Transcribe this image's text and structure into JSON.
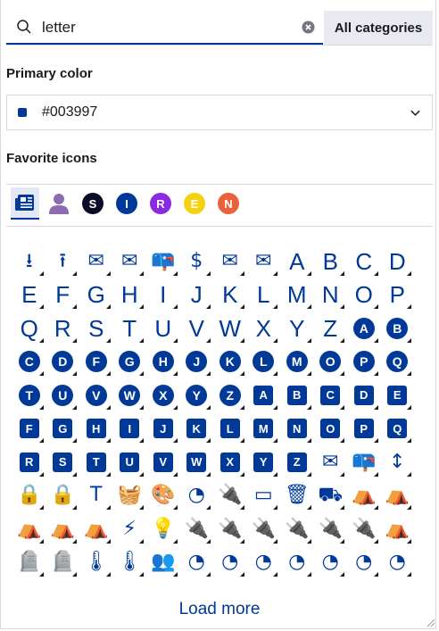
{
  "search": {
    "value": "letter",
    "clear_icon": "close-circle-icon",
    "search_icon": "search-icon"
  },
  "category_button": {
    "label": "All categories"
  },
  "primary_color": {
    "label": "Primary color",
    "value": "#003997",
    "swatch": "#003997"
  },
  "favorites": {
    "label": "Favorite icons",
    "items": [
      {
        "kind": "icon",
        "icon": "newspaper-icon",
        "selected": true
      },
      {
        "kind": "icon",
        "icon": "user-icon",
        "color": "#8c6bb1"
      },
      {
        "kind": "circle",
        "text": "S",
        "color": "#0b0b2a"
      },
      {
        "kind": "circle",
        "text": "I",
        "color": "#003997"
      },
      {
        "kind": "circle",
        "text": "R",
        "color": "#8a2be2"
      },
      {
        "kind": "circle",
        "text": "E",
        "color": "#f5d20f"
      },
      {
        "kind": "circle",
        "text": "N",
        "color": "#e8623a"
      }
    ]
  },
  "icons": [
    {
      "type": "icon",
      "glyph": "⭳",
      "name": "download-icon"
    },
    {
      "type": "icon",
      "glyph": "⭱",
      "name": "upload-icon"
    },
    {
      "type": "icon",
      "glyph": "✉",
      "name": "envelope-icon"
    },
    {
      "type": "icon",
      "glyph": "✉",
      "name": "envelope-open-icon"
    },
    {
      "type": "icon",
      "glyph": "📪",
      "name": "mailbox-icon"
    },
    {
      "type": "icon",
      "glyph": "$",
      "name": "envelope-dollar-icon"
    },
    {
      "type": "icon",
      "glyph": "✉",
      "name": "envelope-open-text-icon"
    },
    {
      "type": "icon",
      "glyph": "✉",
      "name": "mail-bulk-icon"
    },
    {
      "type": "letter",
      "text": "A"
    },
    {
      "type": "letter",
      "text": "B"
    },
    {
      "type": "letter",
      "text": "C"
    },
    {
      "type": "letter",
      "text": "D"
    },
    {
      "type": "letter",
      "text": "E"
    },
    {
      "type": "letter",
      "text": "F"
    },
    {
      "type": "letter",
      "text": "G"
    },
    {
      "type": "letter",
      "text": "H"
    },
    {
      "type": "letter",
      "text": "I"
    },
    {
      "type": "letter",
      "text": "J"
    },
    {
      "type": "letter",
      "text": "K"
    },
    {
      "type": "letter",
      "text": "L"
    },
    {
      "type": "letter",
      "text": "M"
    },
    {
      "type": "letter",
      "text": "N"
    },
    {
      "type": "letter",
      "text": "O"
    },
    {
      "type": "letter",
      "text": "P"
    },
    {
      "type": "letter",
      "text": "Q"
    },
    {
      "type": "letter",
      "text": "R"
    },
    {
      "type": "letter",
      "text": "S"
    },
    {
      "type": "letter",
      "text": "T"
    },
    {
      "type": "letter",
      "text": "U"
    },
    {
      "type": "letter",
      "text": "V"
    },
    {
      "type": "letter",
      "text": "W"
    },
    {
      "type": "letter",
      "text": "X"
    },
    {
      "type": "letter",
      "text": "Y"
    },
    {
      "type": "letter",
      "text": "Z"
    },
    {
      "type": "circle",
      "text": "A"
    },
    {
      "type": "circle",
      "text": "B"
    },
    {
      "type": "circle",
      "text": "C"
    },
    {
      "type": "circle",
      "text": "D"
    },
    {
      "type": "circle",
      "text": "F"
    },
    {
      "type": "circle",
      "text": "G"
    },
    {
      "type": "circle",
      "text": "H"
    },
    {
      "type": "circle",
      "text": "J"
    },
    {
      "type": "circle",
      "text": "K"
    },
    {
      "type": "circle",
      "text": "L"
    },
    {
      "type": "circle",
      "text": "M"
    },
    {
      "type": "circle",
      "text": "O"
    },
    {
      "type": "circle",
      "text": "P"
    },
    {
      "type": "circle",
      "text": "Q"
    },
    {
      "type": "circle",
      "text": "T"
    },
    {
      "type": "circle",
      "text": "U"
    },
    {
      "type": "circle",
      "text": "V"
    },
    {
      "type": "circle",
      "text": "W"
    },
    {
      "type": "circle",
      "text": "X"
    },
    {
      "type": "circle",
      "text": "Y"
    },
    {
      "type": "circle",
      "text": "Z"
    },
    {
      "type": "square",
      "text": "A"
    },
    {
      "type": "square",
      "text": "B"
    },
    {
      "type": "square",
      "text": "C"
    },
    {
      "type": "square",
      "text": "D"
    },
    {
      "type": "square",
      "text": "E"
    },
    {
      "type": "square",
      "text": "F"
    },
    {
      "type": "square",
      "text": "G"
    },
    {
      "type": "square",
      "text": "H"
    },
    {
      "type": "square",
      "text": "I"
    },
    {
      "type": "square",
      "text": "J"
    },
    {
      "type": "square",
      "text": "K"
    },
    {
      "type": "square",
      "text": "L"
    },
    {
      "type": "square",
      "text": "M"
    },
    {
      "type": "square",
      "text": "N"
    },
    {
      "type": "square",
      "text": "O"
    },
    {
      "type": "square",
      "text": "P"
    },
    {
      "type": "square",
      "text": "Q"
    },
    {
      "type": "square",
      "text": "R"
    },
    {
      "type": "square",
      "text": "S"
    },
    {
      "type": "square",
      "text": "T"
    },
    {
      "type": "square",
      "text": "U"
    },
    {
      "type": "square",
      "text": "V"
    },
    {
      "type": "square",
      "text": "W"
    },
    {
      "type": "square",
      "text": "X"
    },
    {
      "type": "square",
      "text": "Y"
    },
    {
      "type": "square",
      "text": "Z"
    },
    {
      "type": "icon",
      "glyph": "✉",
      "name": "square-envelope-icon"
    },
    {
      "type": "icon",
      "glyph": "📪",
      "name": "mailbox-flag-icon"
    },
    {
      "type": "icon",
      "glyph": "↕",
      "name": "arrow-up-down-list-icon"
    },
    {
      "type": "icon",
      "glyph": "🔒",
      "name": "lock-a-icon"
    },
    {
      "type": "icon",
      "glyph": "🔒",
      "name": "lock-a-square-icon"
    },
    {
      "type": "icon",
      "glyph": "T",
      "name": "text-icon"
    },
    {
      "type": "icon",
      "glyph": "🧺",
      "name": "basket-icon"
    },
    {
      "type": "icon",
      "glyph": "🎨",
      "name": "palette-icon"
    },
    {
      "type": "icon",
      "glyph": "◔",
      "name": "gauge-bolt-icon"
    },
    {
      "type": "icon",
      "glyph": "🔌",
      "name": "plug-icon"
    },
    {
      "type": "icon",
      "glyph": "▭",
      "name": "battery-icon"
    },
    {
      "type": "icon",
      "glyph": "🗑",
      "name": "trash-bin-icon"
    },
    {
      "type": "icon",
      "glyph": "⛟",
      "name": "wagon-icon"
    },
    {
      "type": "icon",
      "glyph": "⛺",
      "name": "tent-arrow-down-icon"
    },
    {
      "type": "icon",
      "glyph": "⛺",
      "name": "tent-arrows-icon"
    },
    {
      "type": "icon",
      "glyph": "⛺",
      "name": "tent-arrow-turn-icon"
    },
    {
      "type": "icon",
      "glyph": "⛺",
      "name": "tents-arrow-down-icon"
    },
    {
      "type": "icon",
      "glyph": "⛺",
      "name": "tent-icon"
    },
    {
      "type": "icon",
      "glyph": "⚡",
      "name": "bolt-icon"
    },
    {
      "type": "icon",
      "glyph": "💡",
      "name": "lightbulb-icon"
    },
    {
      "type": "icon",
      "glyph": "🔌",
      "name": "plug-bolt-icon"
    },
    {
      "type": "icon",
      "glyph": "🔌",
      "name": "plug-check-icon"
    },
    {
      "type": "icon",
      "glyph": "🔌",
      "name": "plug-exclamation-icon"
    },
    {
      "type": "icon",
      "glyph": "🔌",
      "name": "plug-minus-icon"
    },
    {
      "type": "icon",
      "glyph": "🔌",
      "name": "plug-plus-icon"
    },
    {
      "type": "icon",
      "glyph": "🔌",
      "name": "plug-xmark-icon"
    },
    {
      "type": "icon",
      "glyph": "⛺",
      "name": "people-roof-icon"
    },
    {
      "type": "icon",
      "glyph": "🪦",
      "name": "tombstone-cross-icon"
    },
    {
      "type": "icon",
      "glyph": "🪦",
      "name": "tombstone-icon"
    },
    {
      "type": "icon",
      "glyph": "🌡",
      "name": "temperature-arrow-down-icon"
    },
    {
      "type": "icon",
      "glyph": "🌡",
      "name": "temperature-arrow-up-icon"
    },
    {
      "type": "icon",
      "glyph": "👥",
      "name": "user-group-icon"
    },
    {
      "type": "icon",
      "glyph": "◔",
      "name": "gauge-icon"
    },
    {
      "type": "icon",
      "glyph": "◔",
      "name": "gauge-minus-icon"
    },
    {
      "type": "icon",
      "glyph": "◔",
      "name": "gauge-plus-icon"
    },
    {
      "type": "icon",
      "glyph": "◔",
      "name": "gauge-low-icon"
    },
    {
      "type": "icon",
      "glyph": "◔",
      "name": "gauge-medium-icon"
    },
    {
      "type": "icon",
      "glyph": "◔",
      "name": "gauge-high-icon"
    },
    {
      "type": "icon",
      "glyph": "◔",
      "name": "gauge-max-icon"
    }
  ],
  "load_more": {
    "label": "Load more"
  },
  "colors": {
    "accent": "#003997",
    "border": "#d7d8e2",
    "category_bg": "#e9eaf0"
  }
}
